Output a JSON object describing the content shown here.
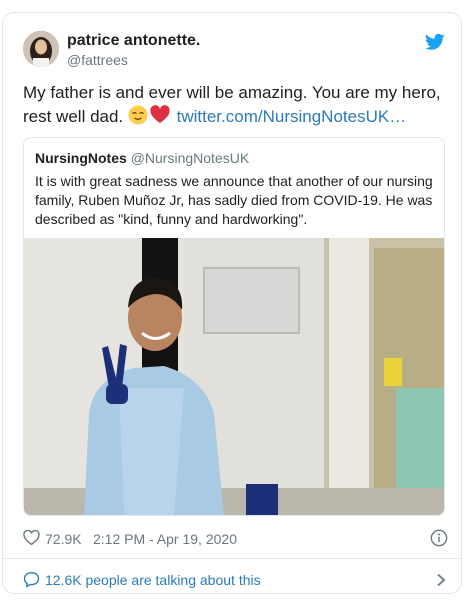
{
  "author": {
    "display_name": "patrice antonette.",
    "handle": "@fattrees"
  },
  "tweet": {
    "text_before": "My father is and ever will be amazing. You are my hero, rest well dad. ",
    "emojis": [
      "relieved-face-emoji",
      "red-heart-emoji"
    ],
    "link": "twitter.com/NursingNotesUK…"
  },
  "quoted_tweet": {
    "name": "NursingNotes",
    "handle": "@NursingNotesUK",
    "text": "It is with great sadness we announce that another of our nursing family, Ruben Muñoz Jr, has sadly died from COVID-19. He was described as \"kind, funny and hardworking\".",
    "image": "photo of a nurse in blue gown and gloves making a peace sign in a hospital corridor"
  },
  "meta": {
    "likes": "72.9K",
    "timestamp": "2:12 PM - Apr 19, 2020"
  },
  "footer": {
    "talking_label": "12.6K people are talking about this"
  },
  "colors": {
    "link": "#2b7bb9",
    "twitter_blue": "#1da1f2",
    "secondary_text": "#697882",
    "border": "#e1e8ed",
    "heart": "#e0245e"
  },
  "icons": [
    "twitter-logo-icon",
    "heart-icon",
    "info-icon",
    "chat-bubble-icon",
    "chevron-right-icon"
  ]
}
